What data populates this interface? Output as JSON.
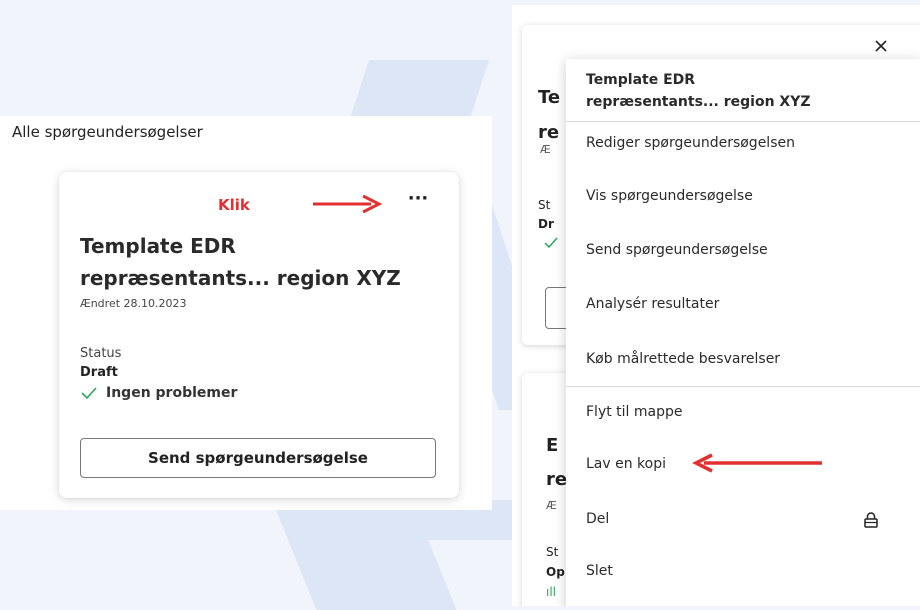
{
  "left": {
    "heading": "Alle spørgeundersøgelser",
    "card": {
      "annotation": "Klik",
      "more_label": "···",
      "title_line1": "Template EDR",
      "title_line2": "repræsentants... region XYZ",
      "modified": "Ændret 28.10.2023",
      "status_label": "Status",
      "status_value": "Draft",
      "check_text": "Ingen problemer",
      "send_button": "Send spørgeundersøgelse"
    }
  },
  "right": {
    "background_fragments": {
      "t1": "Te",
      "t2": "re",
      "t3": "Æ",
      "t4": "St",
      "t5": "Dr",
      "t6": "E",
      "t7": "re",
      "t8": "Æ",
      "t9": "St",
      "t10": "Op",
      "t11": "ıll"
    },
    "close_label": "×",
    "menu": {
      "header_line1": "Template EDR",
      "header_line2": "repræsentants... region XYZ",
      "items": [
        {
          "label": "Rediger spørgeundersøgelsen"
        },
        {
          "label": "Vis spørgeundersøgelse"
        },
        {
          "label": "Send spørgeundersøgelse"
        },
        {
          "label": "Analysér resultater"
        },
        {
          "label": "Køb målrettede besvarelser"
        },
        {
          "label": "Flyt til mappe"
        },
        {
          "label": "Lav en kopi"
        },
        {
          "label": "Del"
        },
        {
          "label": "Slet"
        }
      ]
    }
  },
  "colors": {
    "annotation_red": "#e23030",
    "check_green": "#2aa55a",
    "watermark_blue": "#dde6f6"
  }
}
